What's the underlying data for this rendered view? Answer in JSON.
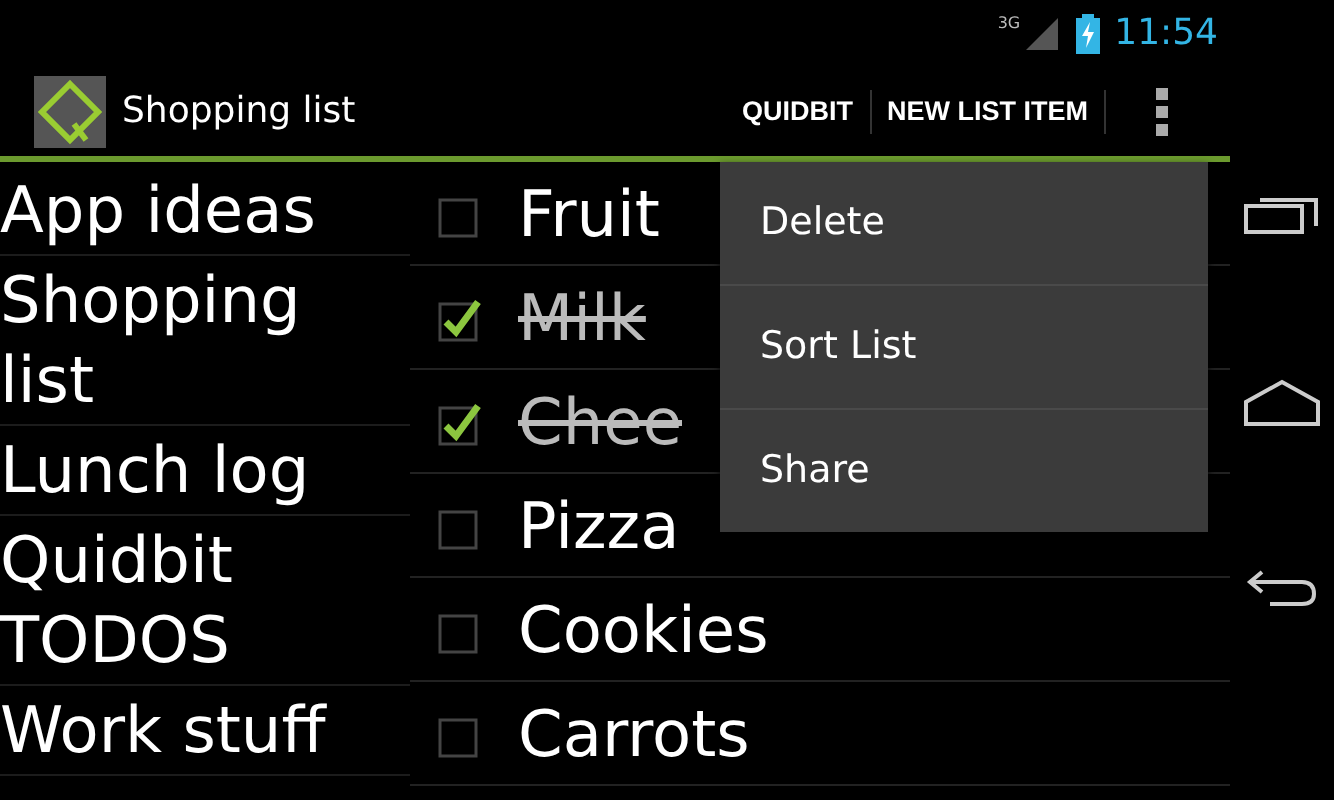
{
  "status_bar": {
    "network": "3G",
    "time": "11:54"
  },
  "action_bar": {
    "title": "Shopping list",
    "actions": [
      "QUIDBIT",
      "NEW LIST ITEM"
    ]
  },
  "lists": [
    {
      "name": "App ideas"
    },
    {
      "name": "Shopping list"
    },
    {
      "name": "Lunch log"
    },
    {
      "name": "Quidbit TODOS"
    },
    {
      "name": "Work stuff"
    }
  ],
  "items": [
    {
      "text": "Fruit",
      "checked": false
    },
    {
      "text": "Milk",
      "checked": true
    },
    {
      "text": "Chee",
      "checked": true
    },
    {
      "text": "Pizza",
      "checked": false
    },
    {
      "text": "Cookies",
      "checked": false
    },
    {
      "text": "Carrots",
      "checked": false
    }
  ],
  "menu": {
    "items": [
      "Delete",
      "Sort List",
      "Share"
    ]
  }
}
